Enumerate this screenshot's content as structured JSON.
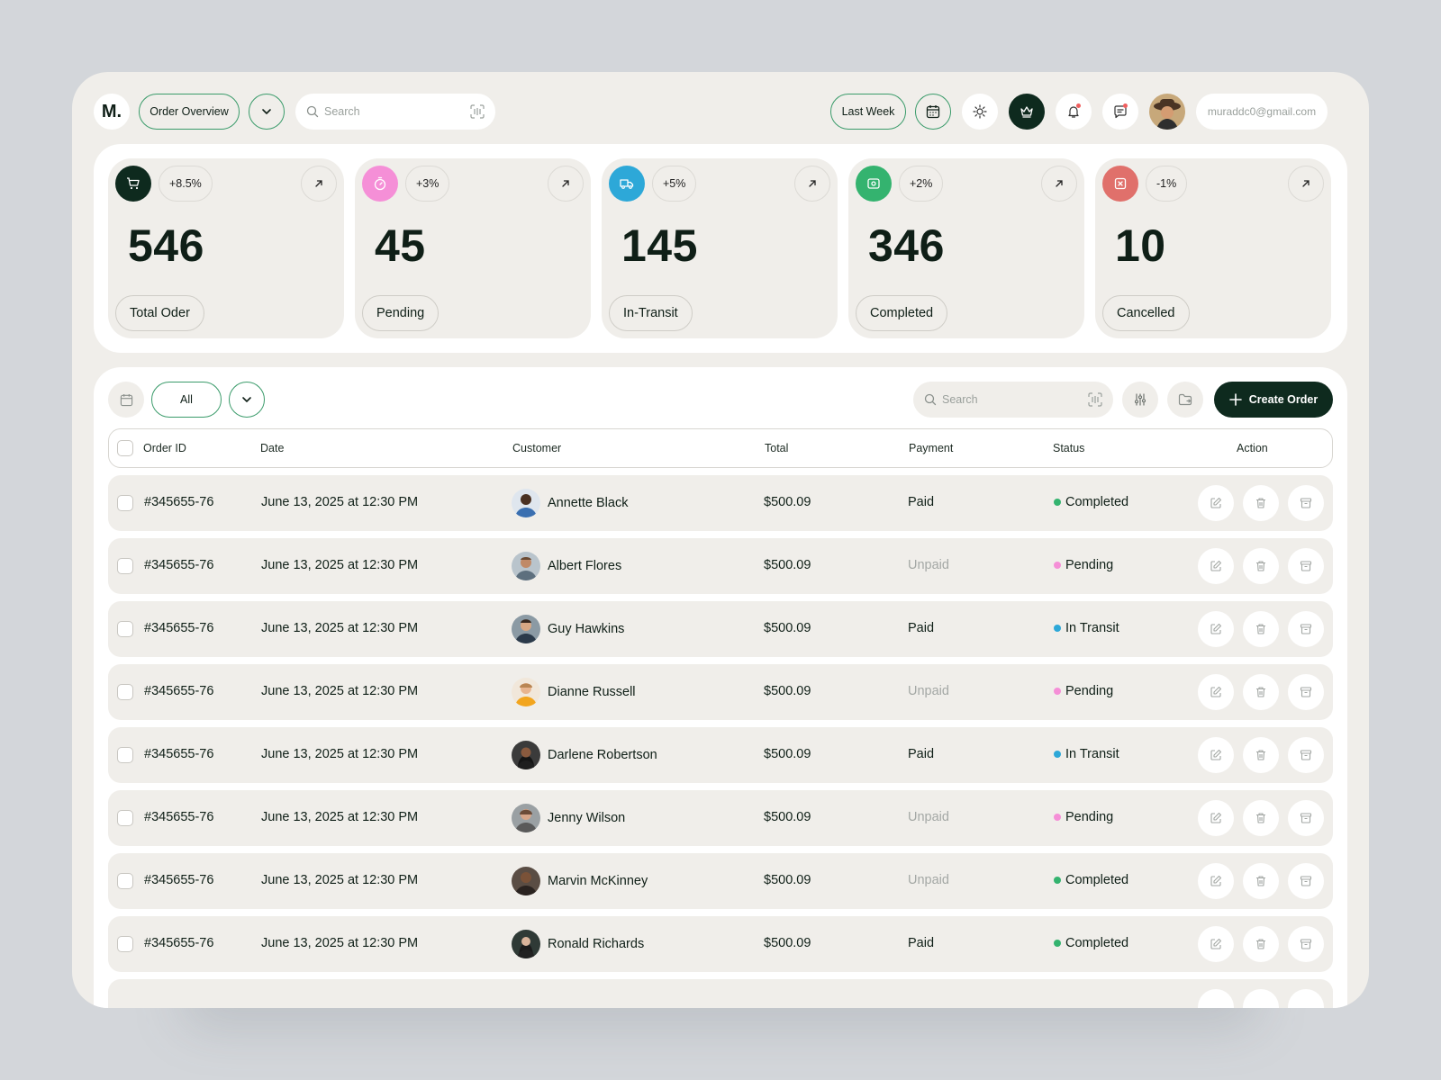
{
  "header": {
    "logo": "M.",
    "view_select": "Order Overview",
    "search_placeholder": "Search",
    "period": "Last Week",
    "email": "muraddc0@gmail.com"
  },
  "stats": [
    {
      "value": "546",
      "label": "Total Oder",
      "change": "+8.5%",
      "color": "#0e2a1e",
      "icon": "cart-icon"
    },
    {
      "value": "45",
      "label": "Pending",
      "change": "+3%",
      "color": "#f58fd7",
      "icon": "timer-icon"
    },
    {
      "value": "145",
      "label": "In-Transit",
      "change": "+5%",
      "color": "#2da8d8",
      "icon": "truck-icon"
    },
    {
      "value": "346",
      "label": "Completed",
      "change": "+2%",
      "color": "#34b36f",
      "icon": "package-check-icon"
    },
    {
      "value": "10",
      "label": "Cancelled",
      "change": "-1%",
      "color": "#e0706b",
      "icon": "x-box-icon"
    }
  ],
  "toolbar": {
    "filter": "All",
    "search_placeholder": "Search",
    "create_label": "Create Order"
  },
  "table": {
    "headers": [
      "Order ID",
      "Date",
      "Customer",
      "Total",
      "Payment",
      "Status",
      "Action"
    ],
    "rows": [
      {
        "id": "#345655-76",
        "date": "June 13, 2025 at 12:30 PM",
        "customer": "Annette Black",
        "total": "$500.09",
        "payment": "Paid",
        "status": "Completed"
      },
      {
        "id": "#345655-76",
        "date": "June 13, 2025 at 12:30 PM",
        "customer": "Albert Flores",
        "total": "$500.09",
        "payment": "Unpaid",
        "status": "Pending"
      },
      {
        "id": "#345655-76",
        "date": "June 13, 2025 at 12:30 PM",
        "customer": "Guy Hawkins",
        "total": "$500.09",
        "payment": "Paid",
        "status": "In Transit"
      },
      {
        "id": "#345655-76",
        "date": "June 13, 2025 at 12:30 PM",
        "customer": "Dianne Russell",
        "total": "$500.09",
        "payment": "Unpaid",
        "status": "Pending"
      },
      {
        "id": "#345655-76",
        "date": "June 13, 2025 at 12:30 PM",
        "customer": "Darlene Robertson",
        "total": "$500.09",
        "payment": "Paid",
        "status": "In Transit"
      },
      {
        "id": "#345655-76",
        "date": "June 13, 2025 at 12:30 PM",
        "customer": "Jenny Wilson",
        "total": "$500.09",
        "payment": "Unpaid",
        "status": "Pending"
      },
      {
        "id": "#345655-76",
        "date": "June 13, 2025 at 12:30 PM",
        "customer": "Marvin McKinney",
        "total": "$500.09",
        "payment": "Unpaid",
        "status": "Completed"
      },
      {
        "id": "#345655-76",
        "date": "June 13, 2025 at 12:30 PM",
        "customer": "Ronald Richards",
        "total": "$500.09",
        "payment": "Paid",
        "status": "Completed"
      }
    ]
  },
  "colors": {
    "accent_dark": "#0e2a1e",
    "outline_green": "#3a9b6a",
    "status_completed": "#34b36f",
    "status_pending": "#f58fd7",
    "status_in_transit": "#2da8d8"
  }
}
